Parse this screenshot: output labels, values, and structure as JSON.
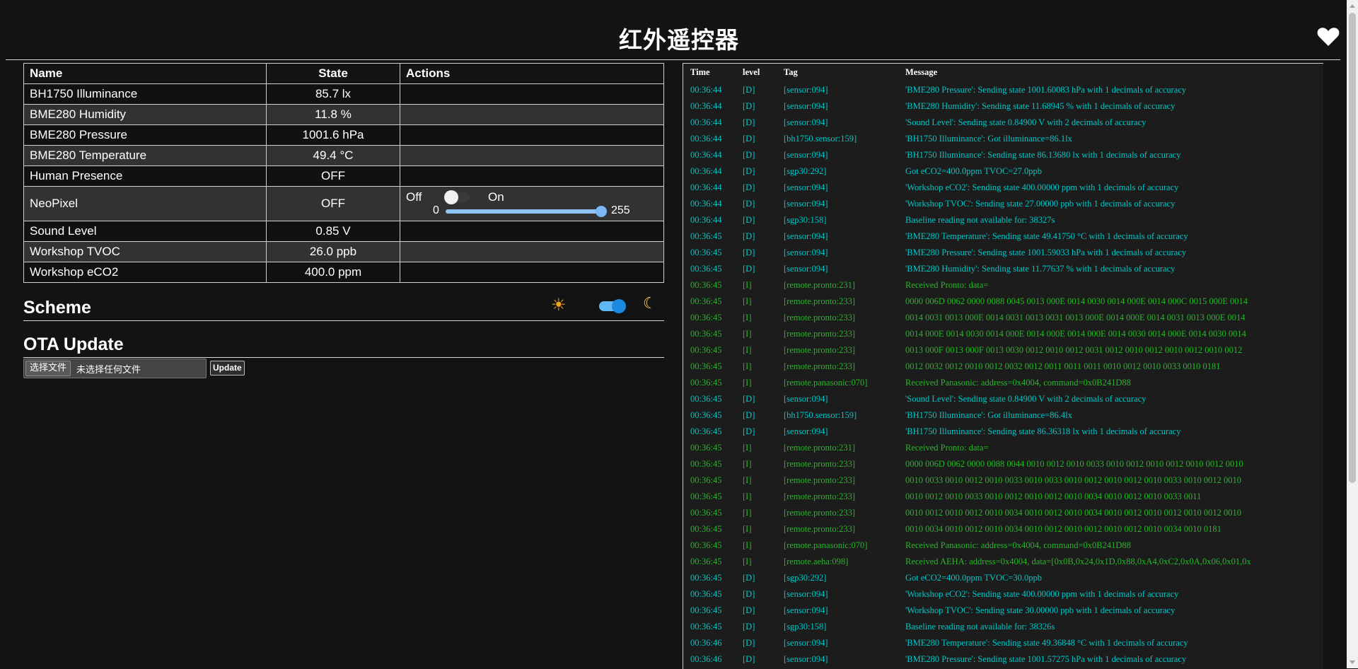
{
  "header": {
    "title": "红外遥控器",
    "favorite_icon": "heart-icon"
  },
  "states_table": {
    "columns": [
      "Name",
      "State",
      "Actions"
    ],
    "rows": [
      {
        "name": "BH1750 Illuminance",
        "state": "85.7 lx"
      },
      {
        "name": "BME280 Humidity",
        "state": "11.8 %"
      },
      {
        "name": "BME280 Pressure",
        "state": "1001.6 hPa"
      },
      {
        "name": "BME280 Temperature",
        "state": "49.4 °C"
      },
      {
        "name": "Human Presence",
        "state": "OFF"
      },
      {
        "name": "NeoPixel",
        "state": "OFF"
      },
      {
        "name": "Sound Level",
        "state": "0.85 V"
      },
      {
        "name": "Workshop TVOC",
        "state": "26.0 ppb"
      },
      {
        "name": "Workshop eCO2",
        "state": "400.0 ppm"
      }
    ],
    "neopixel_actions": {
      "off_label": "Off",
      "on_label": "On",
      "switch_on": false,
      "brightness_min": "0",
      "brightness_max": "255",
      "brightness_value": 255
    }
  },
  "scheme": {
    "title": "Scheme",
    "sun_icon": "sun-icon",
    "moon_icon": "moon-icon",
    "dark_mode": true
  },
  "ota": {
    "title": "OTA Update",
    "choose_label": "选择文件",
    "file_status": "未选择任何文件",
    "update_label": "Update"
  },
  "log": {
    "columns": [
      "Time",
      "level",
      "Tag",
      "Message"
    ],
    "rows": [
      {
        "time": "00:36:44",
        "level": "[D]",
        "tag": "[sensor:094]",
        "msg": "'BME280 Pressure': Sending state 1001.60083 hPa with 1 decimals of accuracy"
      },
      {
        "time": "00:36:44",
        "level": "[D]",
        "tag": "[sensor:094]",
        "msg": "'BME280 Humidity': Sending state 11.68945 % with 1 decimals of accuracy"
      },
      {
        "time": "00:36:44",
        "level": "[D]",
        "tag": "[sensor:094]",
        "msg": "'Sound Level': Sending state 0.84900 V with 2 decimals of accuracy"
      },
      {
        "time": "00:36:44",
        "level": "[D]",
        "tag": "[bh1750.sensor:159]",
        "msg": "'BH1750 Illuminance': Got illuminance=86.1lx"
      },
      {
        "time": "00:36:44",
        "level": "[D]",
        "tag": "[sensor:094]",
        "msg": "'BH1750 Illuminance': Sending state 86.13680 lx with 1 decimals of accuracy"
      },
      {
        "time": "00:36:44",
        "level": "[D]",
        "tag": "[sgp30:292]",
        "msg": "Got eCO2=400.0ppm TVOC=27.0ppb"
      },
      {
        "time": "00:36:44",
        "level": "[D]",
        "tag": "[sensor:094]",
        "msg": "'Workshop eCO2': Sending state 400.00000 ppm with 1 decimals of accuracy"
      },
      {
        "time": "00:36:44",
        "level": "[D]",
        "tag": "[sensor:094]",
        "msg": "'Workshop TVOC': Sending state 27.00000 ppb with 1 decimals of accuracy"
      },
      {
        "time": "00:36:44",
        "level": "[D]",
        "tag": "[sgp30:158]",
        "msg": "Baseline reading not available for: 38327s"
      },
      {
        "time": "00:36:45",
        "level": "[D]",
        "tag": "[sensor:094]",
        "msg": "'BME280 Temperature': Sending state 49.41750 °C with 1 decimals of accuracy"
      },
      {
        "time": "00:36:45",
        "level": "[D]",
        "tag": "[sensor:094]",
        "msg": "'BME280 Pressure': Sending state 1001.59033 hPa with 1 decimals of accuracy"
      },
      {
        "time": "00:36:45",
        "level": "[D]",
        "tag": "[sensor:094]",
        "msg": "'BME280 Humidity': Sending state 11.77637 % with 1 decimals of accuracy"
      },
      {
        "time": "00:36:45",
        "level": "[I]",
        "tag": "[remote.pronto:231]",
        "msg": "Received Pronto: data="
      },
      {
        "time": "00:36:45",
        "level": "[I]",
        "tag": "[remote.pronto:233]",
        "msg": "0000 006D 0062 0000 0088 0045 0013 000E 0014 0030 0014 000E 0014 000C 0015 000E 0014"
      },
      {
        "time": "00:36:45",
        "level": "[I]",
        "tag": "[remote.pronto:233]",
        "msg": "0014 0031 0013 000E 0014 0031 0013 0031 0013 000E 0014 000E 0014 0031 0013 000E 0014"
      },
      {
        "time": "00:36:45",
        "level": "[I]",
        "tag": "[remote.pronto:233]",
        "msg": "0014 000E 0014 0030 0014 000E 0014 000E 0014 000E 0014 0030 0014 000E 0014 0030 0014"
      },
      {
        "time": "00:36:45",
        "level": "[I]",
        "tag": "[remote.pronto:233]",
        "msg": "0013 000F 0013 000F 0013 0030 0012 0010 0012 0031 0012 0010 0012 0010 0012 0010 0012"
      },
      {
        "time": "00:36:45",
        "level": "[I]",
        "tag": "[remote.pronto:233]",
        "msg": "0012 0032 0012 0010 0012 0032 0012 0011 0011 0011 0010 0012 0010 0033 0010 0181"
      },
      {
        "time": "00:36:45",
        "level": "[I]",
        "tag": "[remote.panasonic:070]",
        "msg": "Received Panasonic: address=0x4004, command=0x0B241D88"
      },
      {
        "time": "00:36:45",
        "level": "[D]",
        "tag": "[sensor:094]",
        "msg": "'Sound Level': Sending state 0.84900 V with 2 decimals of accuracy"
      },
      {
        "time": "00:36:45",
        "level": "[D]",
        "tag": "[bh1750.sensor:159]",
        "msg": "'BH1750 Illuminance': Got illuminance=86.4lx"
      },
      {
        "time": "00:36:45",
        "level": "[D]",
        "tag": "[sensor:094]",
        "msg": "'BH1750 Illuminance': Sending state 86.36318 lx with 1 decimals of accuracy"
      },
      {
        "time": "00:36:45",
        "level": "[I]",
        "tag": "[remote.pronto:231]",
        "msg": "Received Pronto: data="
      },
      {
        "time": "00:36:45",
        "level": "[I]",
        "tag": "[remote.pronto:233]",
        "msg": "0000 006D 0062 0000 0088 0044 0010 0012 0010 0033 0010 0012 0010 0012 0010 0012 0010"
      },
      {
        "time": "00:36:45",
        "level": "[I]",
        "tag": "[remote.pronto:233]",
        "msg": "0010 0033 0010 0012 0010 0033 0010 0033 0010 0012 0010 0012 0010 0033 0010 0012 0010"
      },
      {
        "time": "00:36:45",
        "level": "[I]",
        "tag": "[remote.pronto:233]",
        "msg": "0010 0012 0010 0033 0010 0012 0010 0012 0010 0034 0010 0012 0010 0033 0011"
      },
      {
        "time": "00:36:45",
        "level": "[I]",
        "tag": "[remote.pronto:233]",
        "msg": "0010 0012 0010 0012 0010 0034 0010 0012 0010 0034 0010 0012 0010 0012 0010 0012 0010"
      },
      {
        "time": "00:36:45",
        "level": "[I]",
        "tag": "[remote.pronto:233]",
        "msg": "0010 0034 0010 0012 0010 0034 0010 0012 0010 0012 0010 0012 0010 0034 0010 0181"
      },
      {
        "time": "00:36:45",
        "level": "[I]",
        "tag": "[remote.panasonic:070]",
        "msg": "Received Panasonic: address=0x4004, command=0x0B241D88"
      },
      {
        "time": "00:36:45",
        "level": "[I]",
        "tag": "[remote.aeha:098]",
        "msg": "Received AEHA: address=0x4004, data=[0x0B,0x24,0x1D,0x88,0xA4,0xC2,0x0A,0x06,0x01,0x"
      },
      {
        "time": "00:36:45",
        "level": "[D]",
        "tag": "[sgp30:292]",
        "msg": "Got eCO2=400.0ppm TVOC=30.0ppb"
      },
      {
        "time": "00:36:45",
        "level": "[D]",
        "tag": "[sensor:094]",
        "msg": "'Workshop eCO2': Sending state 400.00000 ppm with 1 decimals of accuracy"
      },
      {
        "time": "00:36:45",
        "level": "[D]",
        "tag": "[sensor:094]",
        "msg": "'Workshop TVOC': Sending state 30.00000 ppb with 1 decimals of accuracy"
      },
      {
        "time": "00:36:45",
        "level": "[D]",
        "tag": "[sgp30:158]",
        "msg": "Baseline reading not available for: 38326s"
      },
      {
        "time": "00:36:46",
        "level": "[D]",
        "tag": "[sensor:094]",
        "msg": "'BME280 Temperature': Sending state 49.36848 °C with 1 decimals of accuracy"
      },
      {
        "time": "00:36:46",
        "level": "[D]",
        "tag": "[sensor:094]",
        "msg": "'BME280 Pressure': Sending state 1001.57275 hPa with 1 decimals of accuracy"
      }
    ]
  },
  "colors": {
    "background": "#131313",
    "debug_level": "#00c8c8",
    "info_level": "#27b727",
    "switch_accent": "#1a8ae0"
  }
}
